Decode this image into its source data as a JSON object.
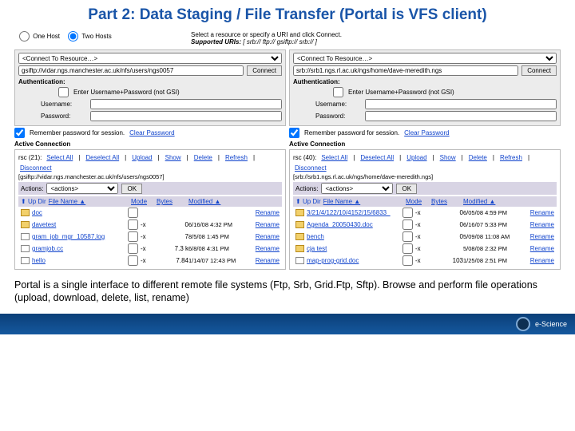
{
  "title": "Part 2: Data Staging / File Transfer (Portal is VFS client)",
  "hosts": {
    "one": "One Host",
    "two": "Two Hosts",
    "selected": "two"
  },
  "desc1": "Select a resource or specify a URI and click Connect.",
  "desc2_lead": "Supported URIs:",
  "desc2_rest": "[ srb:// ftp:// gsiftp:// srb:// ]",
  "placeholder_resource": "<Connect To Resource…>",
  "connect": "Connect",
  "auth_hdr": "Authentication:",
  "auth_check": "Enter Username+Password (not GSI)",
  "user_lbl": "Username:",
  "pass_lbl": "Password:",
  "remember": "Remember password for session.",
  "clearpw": "Clear Password",
  "active": "Active Connection",
  "toolbar": {
    "selall": "Select All",
    "desel": "Deselect All",
    "upload": "Upload",
    "show": "Show",
    "del": "Delete",
    "refresh": "Refresh",
    "disc": "Disconnect"
  },
  "actions_lbl": "Actions:",
  "actions_ph": "<actions>",
  "ok": "OK",
  "updir": "Up Dir",
  "col_name": "File Name ▲",
  "col_mode": "Mode",
  "col_bytes": "Bytes",
  "col_mod": "Modified ▲",
  "rename": "Rename",
  "left": {
    "uri": "gsiftp://vidar.ngs.manchester.ac.uk/nfs/users/ngs0057",
    "rsc": "rsc (21):",
    "path": "[gsiftp://vidar.ngs.manchester.ac.uk/nfs/users/ngs0057]",
    "files": [
      {
        "t": "d",
        "n": "doc",
        "m": "",
        "b": "",
        "d": ""
      },
      {
        "t": "d",
        "n": "davetest",
        "m": "-x",
        "b": "0",
        "d": "6/16/08 4:32 PM"
      },
      {
        "t": "f",
        "n": "gram_job_mgr_10587.log",
        "m": "-x",
        "b": "7",
        "d": "8/5/08 1:45 PM"
      },
      {
        "t": "f",
        "n": "gramjob.cc",
        "m": "-x",
        "b": "7.3 k",
        "d": "6/8/08 4:31 PM"
      },
      {
        "t": "f",
        "n": "hello",
        "m": "-x",
        "b": "7.84",
        "d": "1/14/07 12:43 PM"
      }
    ]
  },
  "right": {
    "uri": "srb://srb1.ngs.rl.ac.uk/ngs/home/dave-meredith.ngs",
    "rsc": "rsc (40):",
    "path": "[srb://srb1.ngs.rl.ac.uk/ngs/home/dave-meredith.ngs]",
    "files": [
      {
        "t": "d",
        "n": "3/21/4/122/10/4152/15/6833_",
        "m": "-x",
        "b": "0",
        "d": "6/05/08 4:59 PM"
      },
      {
        "t": "d",
        "n": "Agenda_20050430.doc",
        "m": "-x",
        "b": "0",
        "d": "6/16/07 5:33 PM"
      },
      {
        "t": "d",
        "n": "bench",
        "m": "-x",
        "b": "0",
        "d": "5/09/08 11:08 AM"
      },
      {
        "t": "d",
        "n": "cja test",
        "m": "-x",
        "b": "",
        "d": "5/08/08 2:32 PM"
      },
      {
        "t": "f",
        "n": "map-prog-grid.doc",
        "m": "-x",
        "b": "103",
        "d": "1/25/08 2:51 PM"
      }
    ]
  },
  "footer": "Portal is a single interface to different remote file systems (Ftp, Srb, Grid.Ftp, Sftp). Browse and perform file operations (upload, download, delete, list, rename)",
  "brand": "e-Science"
}
